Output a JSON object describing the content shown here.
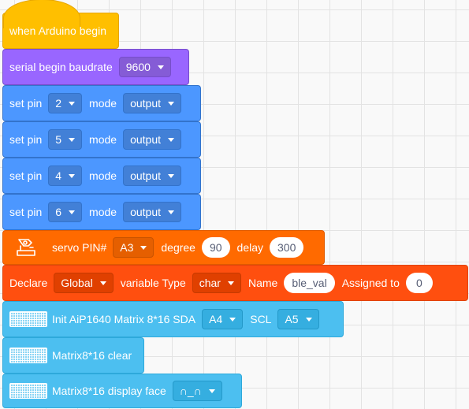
{
  "colors": {
    "event": "#ffbf00",
    "serial": "#9966ff",
    "pin": "#4c97ff",
    "servo": "#ff6a00",
    "variable": "#ff4f0f",
    "matrix": "#4cbff0",
    "grid_background": "#f9f9f9"
  },
  "hat": {
    "label": "when Arduino begin"
  },
  "serial": {
    "label": "serial begin baudrate",
    "baud": "9600"
  },
  "set_pins": [
    {
      "set_label": "set pin",
      "pin": "2",
      "mode_label": "mode",
      "mode": "output"
    },
    {
      "set_label": "set pin",
      "pin": "5",
      "mode_label": "mode",
      "mode": "output"
    },
    {
      "set_label": "set pin",
      "pin": "4",
      "mode_label": "mode",
      "mode": "output"
    },
    {
      "set_label": "set pin",
      "pin": "6",
      "mode_label": "mode",
      "mode": "output"
    }
  ],
  "servo": {
    "icon": "servo-motor-icon",
    "pin_label": "servo PIN#",
    "pin": "A3",
    "degree_label": "degree",
    "degree": "90",
    "delay_label": "delay",
    "delay": "300"
  },
  "declare": {
    "label": "Declare",
    "scope": "Global",
    "type_label": "variable Type",
    "type": "char",
    "name_label": "Name",
    "name": "ble_val",
    "assigned_label": "Assigned to",
    "value": "0"
  },
  "matrix_init": {
    "icon": "led-matrix-icon",
    "label": "Init AiP1640 Matrix 8*16 SDA",
    "sda": "A4",
    "scl_label": "SCL",
    "scl": "A5"
  },
  "matrix_clear": {
    "icon": "led-matrix-icon",
    "label": "Matrix8*16 clear"
  },
  "matrix_face": {
    "icon": "led-matrix-icon",
    "label": "Matrix8*16 display face",
    "face": "∩_∩"
  }
}
